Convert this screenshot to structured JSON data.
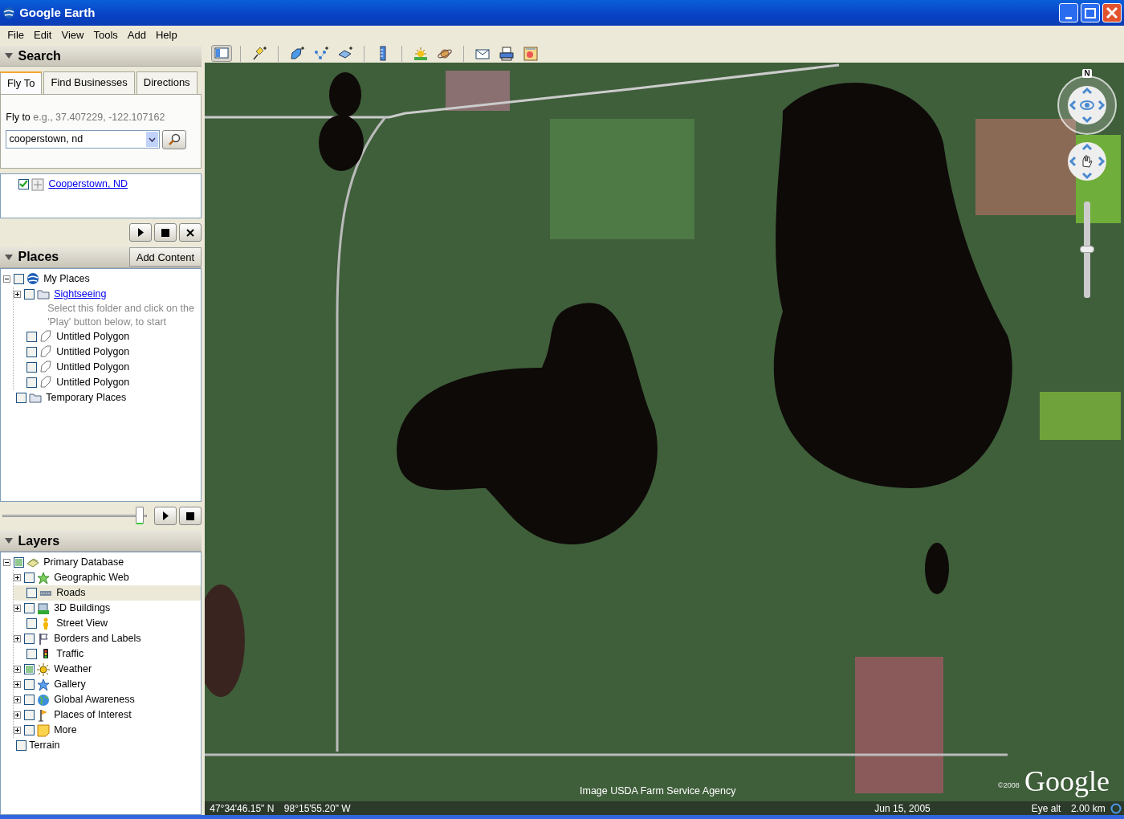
{
  "window": {
    "title": "Google Earth"
  },
  "menu": [
    "File",
    "Edit",
    "View",
    "Tools",
    "Add",
    "Help"
  ],
  "search": {
    "title": "Search",
    "tabs": [
      {
        "label": "Fly To",
        "selected": true
      },
      {
        "label": "Find Businesses",
        "selected": false
      },
      {
        "label": "Directions",
        "selected": false
      }
    ],
    "fly_label": "Fly to",
    "hint": "e.g., 37.407229, -122.107162",
    "value": "cooperstown, nd",
    "results": [
      {
        "label": "Cooperstown, ND",
        "checked": true,
        "kind": "grid",
        "link": true
      }
    ]
  },
  "places": {
    "title": "Places",
    "add_button": "Add Content",
    "tour_slider": {
      "level": 0.97
    },
    "tree": [
      {
        "label": "My Places",
        "kind": "globe",
        "checked": false,
        "expanded": true,
        "children": [
          {
            "label": "Sightseeing",
            "kind": "folder",
            "checked": false,
            "expanded": false,
            "link": true,
            "description": "Select this folder and click on the 'Play' button below, to start"
          },
          {
            "label": "Untitled Polygon",
            "kind": "polygon",
            "checked": false
          },
          {
            "label": "Untitled Polygon",
            "kind": "polygon",
            "checked": false
          },
          {
            "label": "Untitled Polygon",
            "kind": "polygon",
            "checked": false
          },
          {
            "label": "Untitled Polygon",
            "kind": "polygon",
            "checked": false
          }
        ]
      },
      {
        "label": "Temporary Places",
        "kind": "folder",
        "checked": false
      }
    ]
  },
  "layers": {
    "title": "Layers",
    "tree": [
      {
        "label": "Primary Database",
        "kind": "layers",
        "checked": false,
        "partial": true,
        "expanded": true,
        "selected": false,
        "children": [
          {
            "label": "Geographic Web",
            "kind": "star",
            "checked": false,
            "partial": false,
            "expanded": false,
            "selected": false
          },
          {
            "label": "Roads",
            "kind": "road",
            "checked": false,
            "partial": false,
            "selected": true
          },
          {
            "label": "3D Buildings",
            "kind": "building",
            "checked": false,
            "partial": false,
            "expanded": false,
            "selected": false
          },
          {
            "label": "Street View",
            "kind": "person",
            "checked": false,
            "partial": false,
            "selected": false
          },
          {
            "label": "Borders and Labels",
            "kind": "flag",
            "checked": false,
            "partial": false,
            "expanded": false,
            "selected": false
          },
          {
            "label": "Traffic",
            "kind": "traffic",
            "checked": false,
            "partial": false,
            "selected": false
          },
          {
            "label": "Weather",
            "kind": "sun",
            "checked": false,
            "partial": true,
            "expanded": false,
            "selected": false
          },
          {
            "label": "Gallery",
            "kind": "bluestar",
            "checked": false,
            "partial": false,
            "expanded": false,
            "selected": false
          },
          {
            "label": "Global Awareness",
            "kind": "earth",
            "checked": false,
            "partial": false,
            "expanded": false,
            "selected": false
          },
          {
            "label": "Places of Interest",
            "kind": "pin",
            "checked": false,
            "partial": false,
            "expanded": false,
            "selected": false
          },
          {
            "label": "More",
            "kind": "note",
            "checked": false,
            "partial": false,
            "expanded": false,
            "selected": false
          }
        ]
      },
      {
        "label": "Terrain",
        "kind": "none",
        "checked": false,
        "partial": false,
        "selected": false
      }
    ]
  },
  "toolbar": [
    {
      "kind": "sidebar",
      "selected": true
    },
    {
      "kind": "sep"
    },
    {
      "kind": "placemark",
      "selected": false
    },
    {
      "kind": "sep"
    },
    {
      "kind": "polygon",
      "selected": false
    },
    {
      "kind": "path",
      "selected": false
    },
    {
      "kind": "overlay",
      "selected": false
    },
    {
      "kind": "sep"
    },
    {
      "kind": "ruler",
      "selected": false
    },
    {
      "kind": "sep"
    },
    {
      "kind": "sun",
      "selected": false
    },
    {
      "kind": "planet",
      "selected": false
    },
    {
      "kind": "sep"
    },
    {
      "kind": "email",
      "selected": false
    },
    {
      "kind": "print",
      "selected": false
    },
    {
      "kind": "map",
      "selected": false
    }
  ],
  "map": {
    "north": "N",
    "zoom": {
      "level": 0.5
    },
    "attribution": "Image USDA Farm Service Agency",
    "copyright": "©2008",
    "logo": "Google",
    "latitude": "47°34'46.15\" N",
    "longitude": "98°15'55.20\" W",
    "date": "Jun 15, 2005",
    "eye_alt_label": "Eye alt",
    "eye_alt": "2.00 km"
  }
}
